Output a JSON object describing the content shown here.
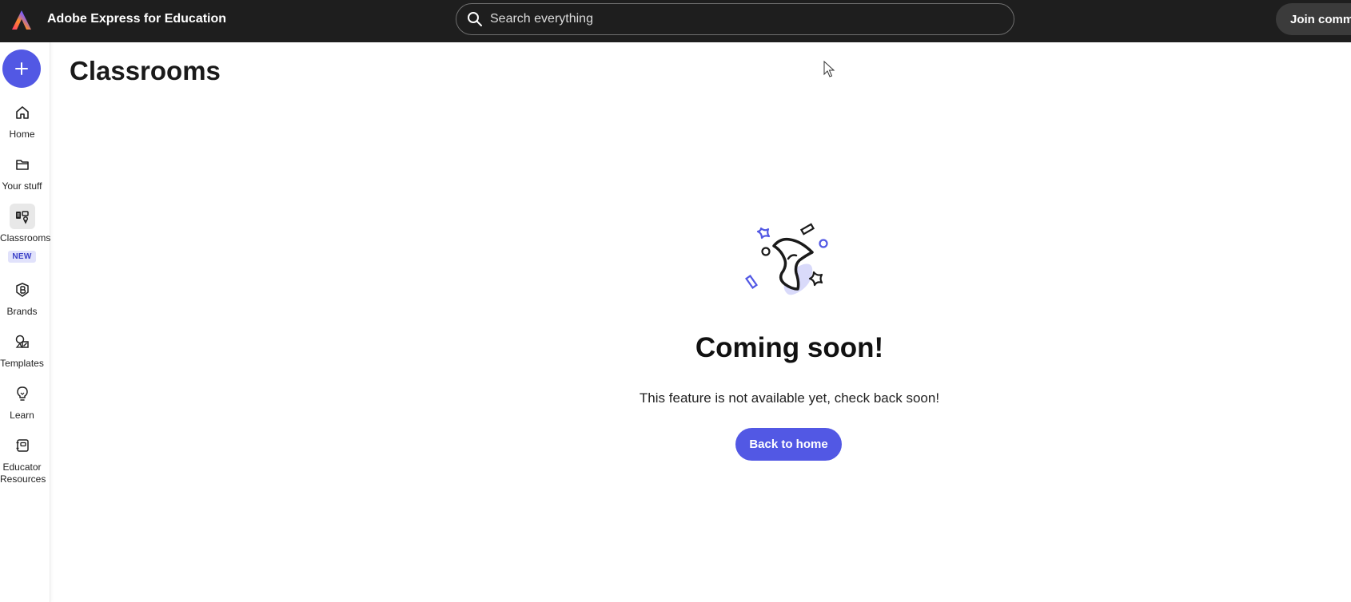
{
  "header": {
    "app_title": "Adobe Express for Education",
    "search_placeholder": "Search everything",
    "join_label": "Join comm"
  },
  "sidebar": {
    "create_icon": "plus-icon",
    "items": [
      {
        "label": "Home",
        "icon": "home-icon"
      },
      {
        "label": "Your stuff",
        "icon": "folder-icon"
      },
      {
        "label": "Classrooms",
        "icon": "classroom-icon",
        "badge": "NEW",
        "active": true
      },
      {
        "label": "Brands",
        "icon": "brand-icon"
      },
      {
        "label": "Templates",
        "icon": "templates-icon"
      },
      {
        "label": "Learn",
        "icon": "lightbulb-icon"
      },
      {
        "label_line1": "Educator",
        "label_line2": "Resources",
        "icon": "educator-icon"
      }
    ]
  },
  "main": {
    "page_title": "Classrooms",
    "empty_state": {
      "illustration": "hourglass-stars-illustration",
      "title": "Coming soon!",
      "description": "This feature is not available yet, check back soon!",
      "button_label": "Back to home"
    }
  },
  "colors": {
    "accent": "#5258e4",
    "topbar": "#1e1e1e",
    "badge_bg": "#e1e2fb"
  }
}
